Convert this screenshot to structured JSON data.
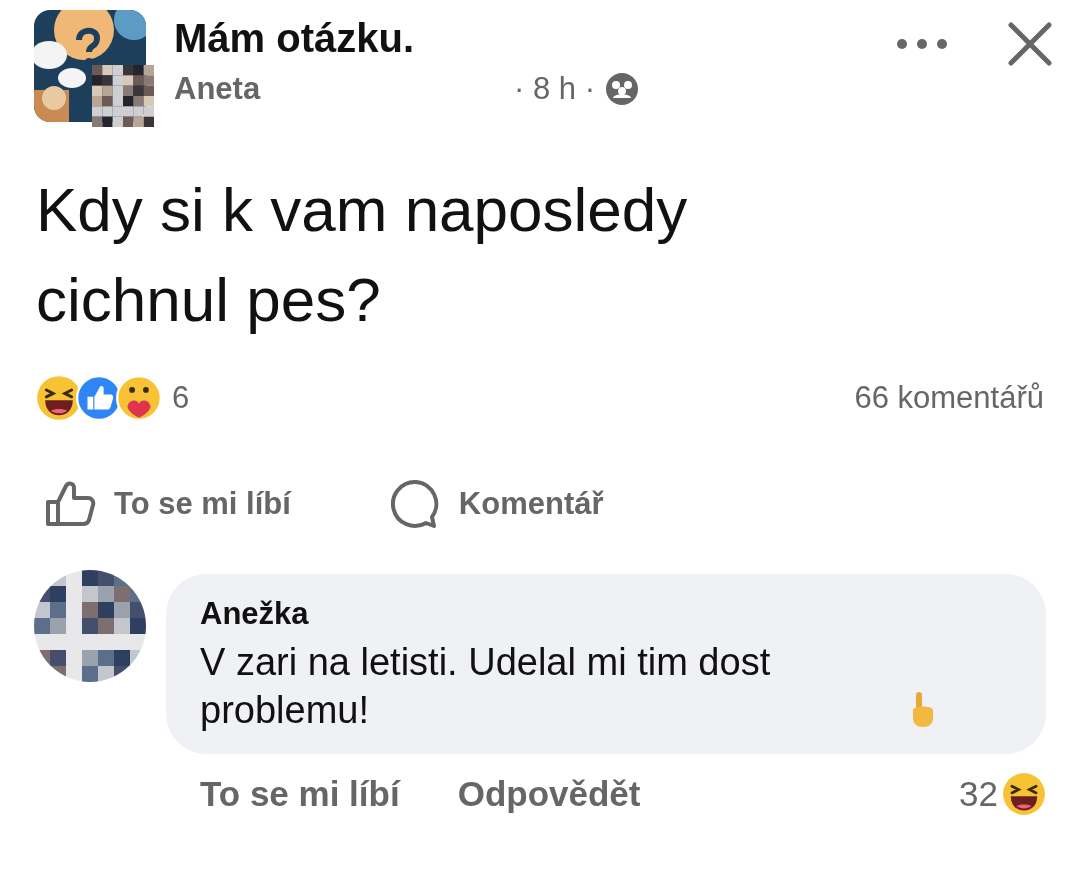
{
  "post": {
    "group": "Mám otázku.",
    "author": "Aneta",
    "time": "· 8 h ·",
    "text": "Kdy si k vam naposledy cichnul pes?"
  },
  "reactions": {
    "count": "6",
    "comments": "66 komentářů"
  },
  "actions": [
    {
      "kind": "like",
      "label": "To se mi líbí"
    },
    {
      "kind": "comment",
      "label": "Komentář"
    }
  ],
  "comment": {
    "author": "Anežka",
    "text": "V zari na letisti. Udelal mi tim dost problemu!",
    "like": "To se mi líbí",
    "reply": "Odpovědět",
    "reaction_count": "32"
  }
}
